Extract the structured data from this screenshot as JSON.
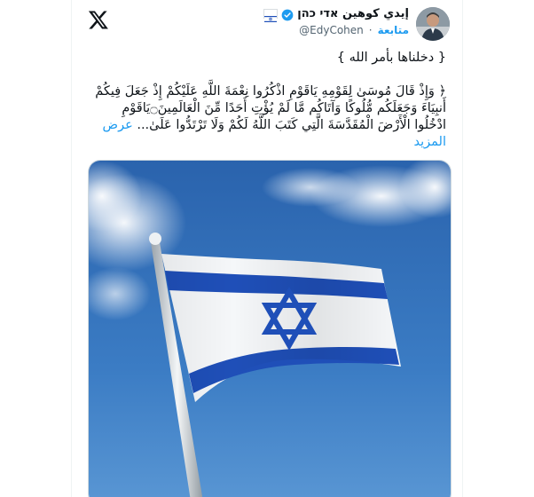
{
  "header": {
    "display_name": "إيدي كوهين אדי כהן",
    "handle": "@EdyCohen",
    "follow_label": "متابعة",
    "separator": "·"
  },
  "tweet": {
    "line1": "{ دخلناها بأمر الله }",
    "line2": "﴿ وَإِذْ قَالَ مُوسَىٰ لِقَوْمِهِ يَاقَوْمِ اذْكُرُوا نِعْمَةَ اللَّهِ عَلَيْكُمْ إِذْ جَعَلَ فِيكُمْ أَنبِيَاءَ وَجَعَلَكُم مُّلُوكًا وَآتَاكُم مَّا لَمْ يُؤْتِ أَحَدًا مِّنَ الْعَالَمِينَ۝يَاقَوْمِ ادْخُلُوا الْأَرْضَ الْمُقَدَّسَةَ الَّتِي كَتَبَ اللَّهُ لَكُمْ وَلَا تَرْتَدُّوا عَلَىٰ...",
    "show_more": "عرض المزيد"
  },
  "media": {
    "description_icon": "israel-flag-image"
  },
  "icons": {
    "logo": "x-logo-icon",
    "verified": "verified-badge-icon",
    "flag": "israel-flag-icon"
  },
  "colors": {
    "accent": "#1d9bf0",
    "flag_blue": "#1f4fb8",
    "sky": "#2f6fb8"
  }
}
